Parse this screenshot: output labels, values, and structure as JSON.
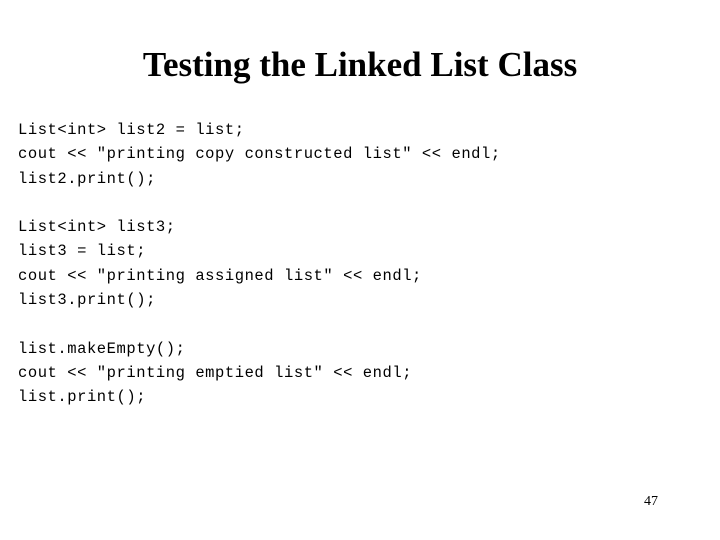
{
  "slide": {
    "title": "Testing the Linked List Class",
    "page_number": "47",
    "background_color": "#ffffff",
    "text_color": "#000000",
    "code_blocks": [
      {
        "lines": [
          "List<int> list2 = list;",
          "cout << \"printing copy constructed list\" << endl;",
          "list2.print();"
        ]
      },
      {
        "lines": [
          "List<int> list3;",
          "list3 = list;",
          "cout << \"printing assigned list\" << endl;",
          "list3.print();"
        ]
      },
      {
        "lines": [
          "list.makeEmpty();",
          "cout << \"printing emptied list\" << endl;",
          "list.print();"
        ]
      }
    ]
  }
}
